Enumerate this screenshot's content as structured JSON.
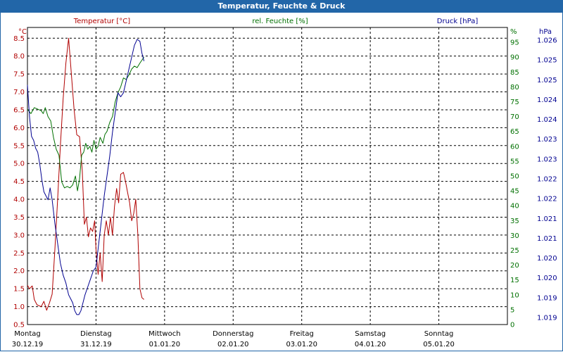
{
  "window": {
    "title": "Temperatur, Feuchte & Druck"
  },
  "chart_data": {
    "type": "line",
    "grid": true,
    "x_categories": [
      {
        "day": "Montag",
        "date": "30.12.19"
      },
      {
        "day": "Dienstag",
        "date": "31.12.19"
      },
      {
        "day": "Mittwoch",
        "date": "01.01.20"
      },
      {
        "day": "Donnerstag",
        "date": "02.01.20"
      },
      {
        "day": "Freitag",
        "date": "03.01.20"
      },
      {
        "day": "Samstag",
        "date": "04.01.20"
      },
      {
        "day": "Sonntag",
        "date": "05.01.20"
      }
    ],
    "axes": {
      "temperature": {
        "label": "Temperatur [°C]",
        "unit": "°C",
        "side": "left",
        "color": "#b00000",
        "min": 0.5,
        "max": 8.8,
        "ticks": [
          "8.5",
          "8.0",
          "7.5",
          "7.0",
          "6.5",
          "6.0",
          "5.5",
          "5.0",
          "4.5",
          "4.0",
          "3.5",
          "3.0",
          "2.5",
          "2.0",
          "1.5",
          "1.0",
          "0.5"
        ]
      },
      "humidity": {
        "label": "rel. Feuchte [%]",
        "unit": "%",
        "side": "right",
        "color": "#007000",
        "min": 0,
        "max": 100,
        "ticks": [
          "95",
          "90",
          "85",
          "80",
          "75",
          "70",
          "65",
          "60",
          "55",
          "50",
          "45",
          "40",
          "35",
          "30",
          "25",
          "20",
          "15",
          "10",
          "5",
          "0"
        ]
      },
      "pressure": {
        "label": "Druck [hPa]",
        "unit": "hPa",
        "side": "right",
        "color": "#000090",
        "min": 1018.75,
        "max": 1026.25,
        "ticks": [
          "1.026",
          "1.025",
          "1.025",
          "1.024",
          "1.024",
          "1.023",
          "1.023",
          "1.022",
          "1.022",
          "1.021",
          "1.021",
          "1.020",
          "1.020",
          "1.019",
          "1.019"
        ]
      }
    },
    "series": [
      {
        "name": "Temperatur [°C]",
        "axis": "temperature",
        "color": "#b00000",
        "values": [
          [
            0,
            1.6
          ],
          [
            0.03,
            1.5
          ],
          [
            0.07,
            1.58
          ],
          [
            0.1,
            1.2
          ],
          [
            0.14,
            1.05
          ],
          [
            0.2,
            1.0
          ],
          [
            0.24,
            1.15
          ],
          [
            0.28,
            0.9
          ],
          [
            0.32,
            1.1
          ],
          [
            0.36,
            1.35
          ],
          [
            0.4,
            2.6
          ],
          [
            0.44,
            4.0
          ],
          [
            0.48,
            5.5
          ],
          [
            0.52,
            6.8
          ],
          [
            0.56,
            7.8
          ],
          [
            0.6,
            8.5
          ],
          [
            0.64,
            7.5
          ],
          [
            0.68,
            6.5
          ],
          [
            0.72,
            5.8
          ],
          [
            0.76,
            5.75
          ],
          [
            0.8,
            4.8
          ],
          [
            0.83,
            3.3
          ],
          [
            0.86,
            3.5
          ],
          [
            0.89,
            2.95
          ],
          [
            0.92,
            3.2
          ],
          [
            0.95,
            3.1
          ],
          [
            0.98,
            3.4
          ],
          [
            1.0,
            2.6
          ],
          [
            1.03,
            1.9
          ],
          [
            1.06,
            2.5
          ],
          [
            1.09,
            1.7
          ],
          [
            1.12,
            3.0
          ],
          [
            1.15,
            3.4
          ],
          [
            1.18,
            3.0
          ],
          [
            1.21,
            3.5
          ],
          [
            1.24,
            3.0
          ],
          [
            1.27,
            3.8
          ],
          [
            1.3,
            4.3
          ],
          [
            1.33,
            3.9
          ],
          [
            1.36,
            4.7
          ],
          [
            1.4,
            4.75
          ],
          [
            1.43,
            4.5
          ],
          [
            1.46,
            4.2
          ],
          [
            1.49,
            3.9
          ],
          [
            1.52,
            3.4
          ],
          [
            1.55,
            3.6
          ],
          [
            1.58,
            4.0
          ],
          [
            1.61,
            3.0
          ],
          [
            1.64,
            1.5
          ],
          [
            1.67,
            1.25
          ],
          [
            1.7,
            1.2
          ]
        ]
      },
      {
        "name": "rel. Feuchte [%]",
        "axis": "humidity",
        "color": "#007000",
        "values": [
          [
            0,
            72.5
          ],
          [
            0.05,
            71
          ],
          [
            0.1,
            73
          ],
          [
            0.15,
            72.5
          ],
          [
            0.2,
            72
          ],
          [
            0.23,
            71
          ],
          [
            0.26,
            73
          ],
          [
            0.3,
            70
          ],
          [
            0.34,
            68.5
          ],
          [
            0.38,
            63
          ],
          [
            0.42,
            59
          ],
          [
            0.46,
            57
          ],
          [
            0.5,
            48
          ],
          [
            0.54,
            46
          ],
          [
            0.58,
            46.5
          ],
          [
            0.62,
            46
          ],
          [
            0.66,
            47
          ],
          [
            0.7,
            50
          ],
          [
            0.73,
            45
          ],
          [
            0.76,
            49
          ],
          [
            0.79,
            57
          ],
          [
            0.82,
            58
          ],
          [
            0.85,
            61
          ],
          [
            0.88,
            59
          ],
          [
            0.91,
            60
          ],
          [
            0.94,
            58
          ],
          [
            0.97,
            62
          ],
          [
            1.0,
            59
          ],
          [
            1.03,
            60
          ],
          [
            1.06,
            63
          ],
          [
            1.1,
            61
          ],
          [
            1.13,
            64
          ],
          [
            1.16,
            65
          ],
          [
            1.2,
            68
          ],
          [
            1.24,
            70
          ],
          [
            1.28,
            75
          ],
          [
            1.32,
            78
          ],
          [
            1.36,
            80
          ],
          [
            1.4,
            83
          ],
          [
            1.44,
            82.5
          ],
          [
            1.48,
            84
          ],
          [
            1.52,
            86
          ],
          [
            1.56,
            87
          ],
          [
            1.6,
            86.5
          ],
          [
            1.64,
            88
          ],
          [
            1.67,
            89
          ],
          [
            1.7,
            90
          ]
        ]
      },
      {
        "name": "Druck [hPa]",
        "axis": "pressure",
        "color": "#000090",
        "values": [
          [
            0,
            1024.8
          ],
          [
            0.03,
            1024.0
          ],
          [
            0.06,
            1023.5
          ],
          [
            0.09,
            1023.4
          ],
          [
            0.12,
            1023.2
          ],
          [
            0.15,
            1023.1
          ],
          [
            0.18,
            1022.8
          ],
          [
            0.21,
            1022.4
          ],
          [
            0.24,
            1022.1
          ],
          [
            0.27,
            1022.0
          ],
          [
            0.3,
            1021.9
          ],
          [
            0.33,
            1022.2
          ],
          [
            0.36,
            1021.9
          ],
          [
            0.4,
            1021.3
          ],
          [
            0.44,
            1020.8
          ],
          [
            0.48,
            1020.3
          ],
          [
            0.52,
            1020.0
          ],
          [
            0.56,
            1019.8
          ],
          [
            0.6,
            1019.5
          ],
          [
            0.63,
            1019.4
          ],
          [
            0.66,
            1019.3
          ],
          [
            0.69,
            1019.1
          ],
          [
            0.72,
            1019.0
          ],
          [
            0.75,
            1019.0
          ],
          [
            0.78,
            1019.1
          ],
          [
            0.81,
            1019.3
          ],
          [
            0.84,
            1019.5
          ],
          [
            0.88,
            1019.7
          ],
          [
            0.92,
            1019.9
          ],
          [
            0.96,
            1020.1
          ],
          [
            1.0,
            1020.2
          ],
          [
            1.04,
            1020.8
          ],
          [
            1.08,
            1021.4
          ],
          [
            1.12,
            1022.0
          ],
          [
            1.16,
            1022.5
          ],
          [
            1.2,
            1023.0
          ],
          [
            1.24,
            1023.6
          ],
          [
            1.28,
            1024.1
          ],
          [
            1.32,
            1024.6
          ],
          [
            1.36,
            1024.5
          ],
          [
            1.4,
            1024.6
          ],
          [
            1.44,
            1024.9
          ],
          [
            1.48,
            1025.2
          ],
          [
            1.52,
            1025.5
          ],
          [
            1.56,
            1025.8
          ],
          [
            1.6,
            1025.95
          ],
          [
            1.64,
            1025.9
          ],
          [
            1.67,
            1025.6
          ],
          [
            1.7,
            1025.4
          ]
        ]
      }
    ]
  }
}
